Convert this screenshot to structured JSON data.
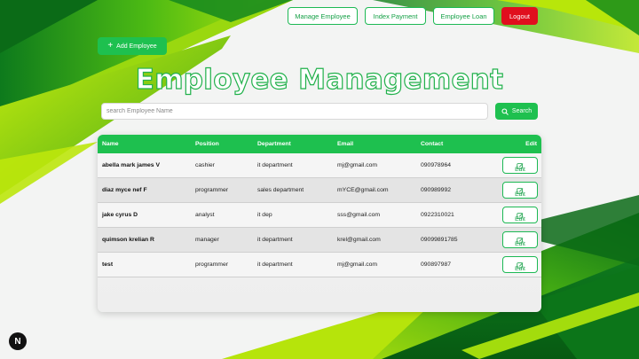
{
  "nav": {
    "manage_employee": "Manage Employee",
    "index_payment": "Index Payment",
    "employee_loan": "Employee Loan",
    "logout": "Logout"
  },
  "add_button": {
    "icon": "plus-icon",
    "label": "Add Employee"
  },
  "page_title": "Employee Management",
  "search": {
    "placeholder": "search Employee Name",
    "value": "",
    "button_label": "Search",
    "icon": "search-icon"
  },
  "table": {
    "headers": [
      "Name",
      "Position",
      "Department",
      "Email",
      "Contact",
      "Edit"
    ],
    "edit_label": "Edit",
    "rows": [
      {
        "name": "abella mark james V",
        "position": "cashier",
        "department": "it department",
        "email": "mj@gmail.com",
        "contact": "090978964"
      },
      {
        "name": "diaz myce nef F",
        "position": "programmer",
        "department": "sales department",
        "email": "mYCE@gmail.com",
        "contact": "090989992"
      },
      {
        "name": "jake cyrus D",
        "position": "analyst",
        "department": "it dep",
        "email": "sss@gmail.com",
        "contact": "0922310021"
      },
      {
        "name": "quimson krelian R",
        "position": "manager",
        "department": "it department",
        "email": "krel@gmail.com",
        "contact": "09099891785"
      },
      {
        "name": "test",
        "position": "programmer",
        "department": "it department",
        "email": "mj@gmail.com",
        "contact": "090897987"
      }
    ]
  },
  "dev_badge": "N",
  "colors": {
    "accent": "#1ec04f",
    "logout": "#e00f1e",
    "title_outline": "#22b14c"
  }
}
